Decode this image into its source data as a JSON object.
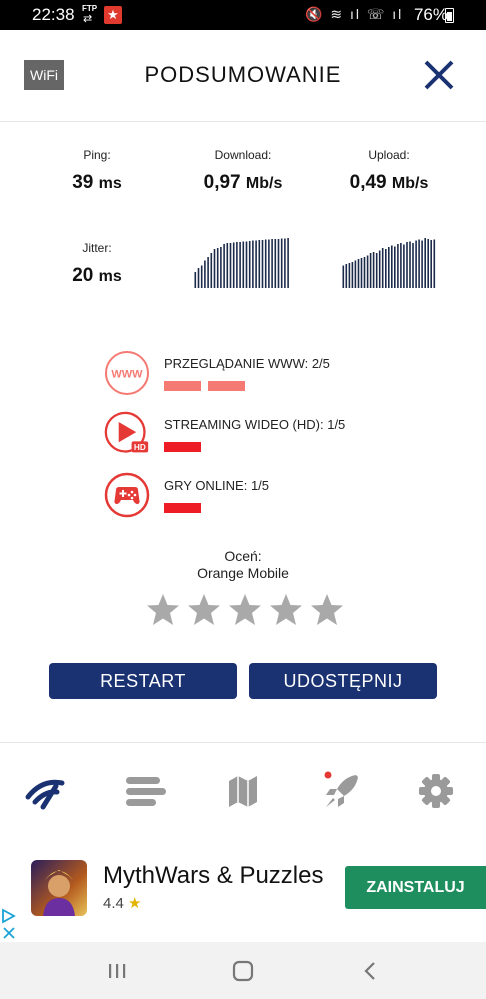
{
  "status": {
    "time": "22:38",
    "ftp": "FTP",
    "battery": "76%"
  },
  "header": {
    "badge": "WiFi",
    "title": "PODSUMOWANIE"
  },
  "metrics": {
    "ping": {
      "label": "Ping:",
      "value": "39",
      "unit": "ms"
    },
    "download": {
      "label": "Download:",
      "value": "0,97",
      "unit": "Mb/s"
    },
    "upload": {
      "label": "Upload:",
      "value": "0,49",
      "unit": "Mb/s"
    },
    "jitter": {
      "label": "Jitter:",
      "value": "20",
      "unit": "ms"
    }
  },
  "graphs": {
    "download": [
      0.32,
      0.4,
      0.45,
      0.55,
      0.62,
      0.7,
      0.78,
      0.8,
      0.82,
      0.88,
      0.9,
      0.9,
      0.91,
      0.92,
      0.92,
      0.93,
      0.93,
      0.94,
      0.95,
      0.95,
      0.96,
      0.96,
      0.97,
      0.97,
      0.98,
      0.98,
      0.98,
      0.99,
      0.99,
      1.0
    ],
    "upload": [
      0.45,
      0.48,
      0.5,
      0.52,
      0.55,
      0.58,
      0.6,
      0.62,
      0.65,
      0.7,
      0.72,
      0.7,
      0.75,
      0.8,
      0.78,
      0.82,
      0.85,
      0.83,
      0.88,
      0.9,
      0.87,
      0.92,
      0.93,
      0.9,
      0.95,
      0.97,
      0.95,
      1.0,
      0.98,
      0.96,
      0.97
    ]
  },
  "quality": [
    {
      "label": "PRZEGLĄDANIE WWW: 2/5",
      "score": 2,
      "max": 5,
      "color": "#f47a73",
      "icon": "www-icon"
    },
    {
      "label": "STREAMING WIDEO (HD): 1/5",
      "score": 1,
      "max": 5,
      "color": "#ee1c24",
      "icon": "video-hd-icon"
    },
    {
      "label": "GRY ONLINE: 1/5",
      "score": 1,
      "max": 5,
      "color": "#ee1c24",
      "icon": "gamepad-icon"
    }
  ],
  "icon_texts": {
    "www": "WWW",
    "hd": "HD"
  },
  "rating": {
    "prompt": "Oceń:",
    "operator": "Orange Mobile",
    "stars": 5,
    "selected": 0
  },
  "buttons": {
    "restart": "RESTART",
    "share": "UDOSTĘPNIJ"
  },
  "tabs": [
    "speed-test-icon",
    "results-list-icon",
    "map-icon",
    "rocket-icon",
    "settings-gear-icon"
  ],
  "ad": {
    "title": "MythWars & Puzzles",
    "rating": "4.4",
    "install": "ZAINSTALUJ"
  },
  "colors": {
    "navy": "#1a3271",
    "bar_light": "#f47a73",
    "bar_red": "#ee1c24",
    "icon_red": "#e53935",
    "icon_light": "#f47a73",
    "install_green": "#1e8e5e",
    "graph": "#1c2a4a",
    "tab_grey": "#9a9a9a"
  }
}
